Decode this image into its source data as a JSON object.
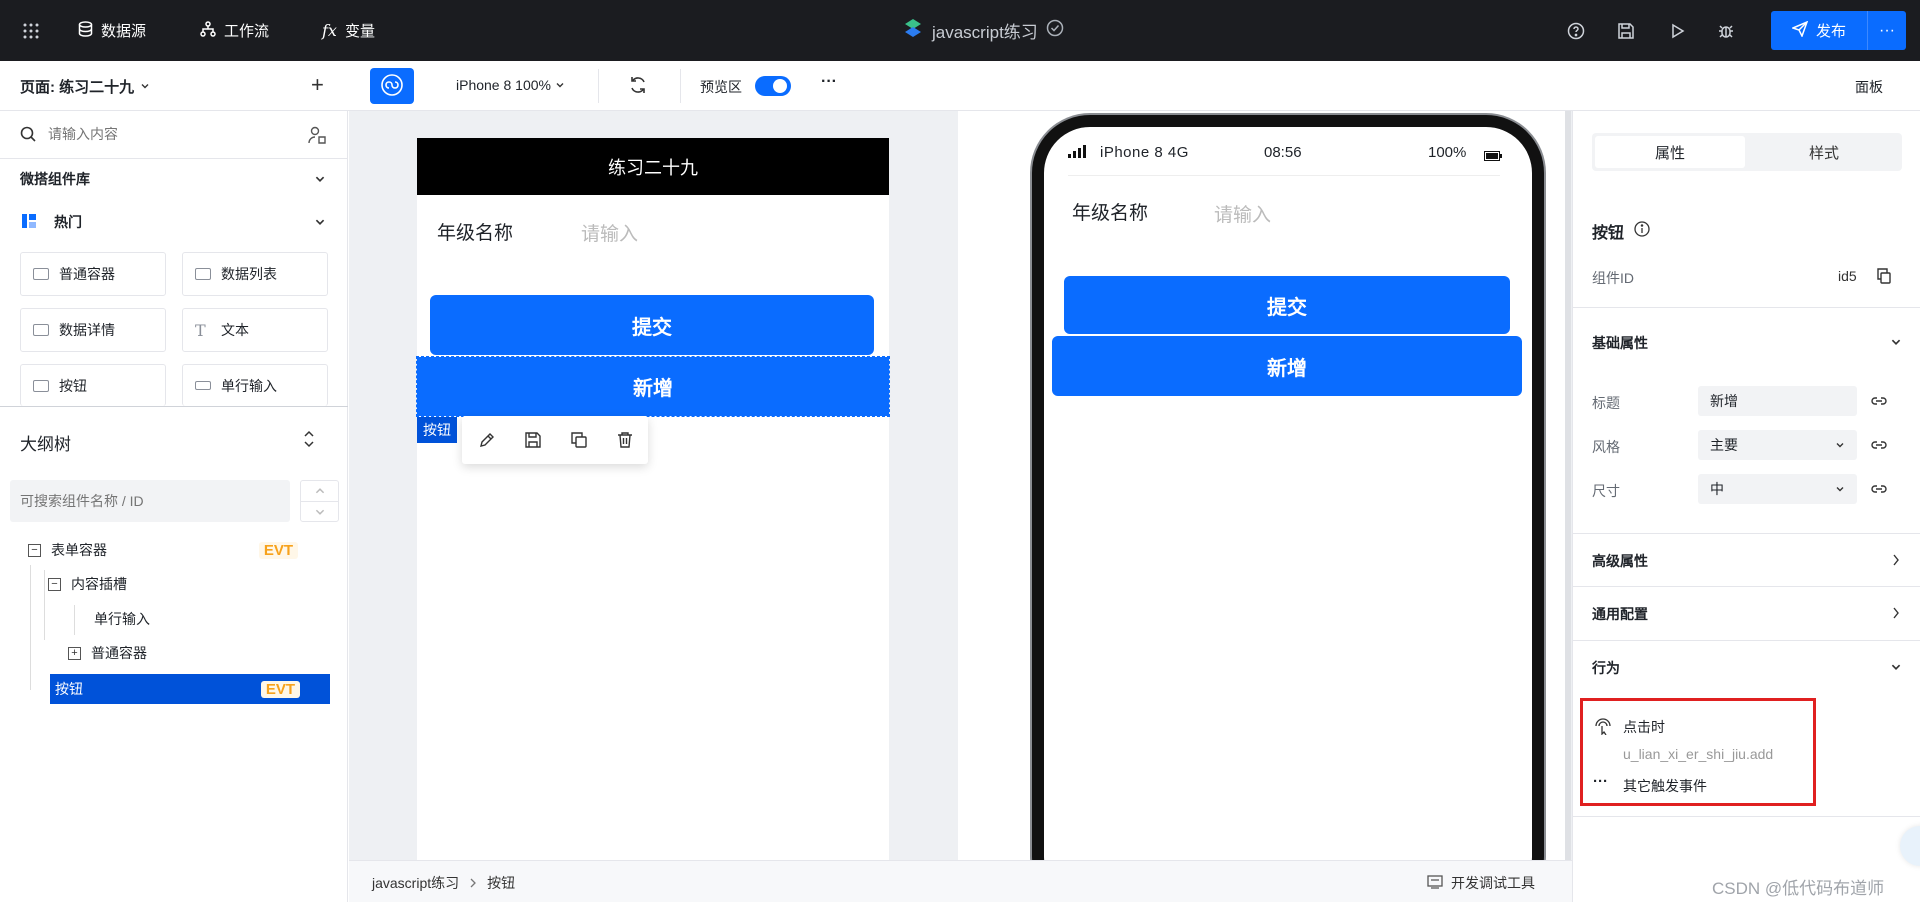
{
  "topbar": {
    "nav": [
      "数据源",
      "工作流",
      "变量"
    ],
    "app_title": "javascript练习",
    "publish_label": "发布",
    "more": "···"
  },
  "toolbar": {
    "device": "iPhone 8 100%",
    "preview_label": "预览区",
    "more": "···",
    "panel_label": "面板"
  },
  "left": {
    "page_label": "页面: 练习二十九",
    "add": "+",
    "search_placeholder": "请输入内容",
    "library_title": "微搭组件库",
    "hot_title": "热门",
    "components": [
      "普通容器",
      "数据列表",
      "数据详情",
      "文本",
      "按钮",
      "单行输入"
    ],
    "outline_title": "大纲树",
    "outline_search_placeholder": "可搜索组件名称 / ID",
    "tree": [
      {
        "label": "表单容器",
        "badge": "EVT"
      },
      {
        "label": "内容插槽"
      },
      {
        "label": "单行输入"
      },
      {
        "label": "普通容器"
      },
      {
        "label": "按钮",
        "badge": "EVT"
      }
    ]
  },
  "canvas": {
    "page_title": "练习二十九",
    "field_label": "年级名称",
    "field_placeholder": "请输入",
    "submit_label": "提交",
    "add_label": "新增",
    "selected_tag": "按钮",
    "phone": {
      "carrier": "iPhone 8  4G",
      "time": "08:56",
      "battery": "100%",
      "field_label": "年级名称",
      "field_placeholder": "请输入",
      "submit_label": "提交",
      "add_label": "新增"
    },
    "breadcrumb": [
      "javascript练习",
      "按钮"
    ],
    "devtools_label": "开发调试工具"
  },
  "right": {
    "tabs": [
      "属性",
      "样式"
    ],
    "component_name": "按钮",
    "component_id_label": "组件ID",
    "component_id": "id5",
    "basic_title": "基础属性",
    "props": [
      {
        "label": "标题",
        "value": "新增"
      },
      {
        "label": "风格",
        "value": "主要"
      },
      {
        "label": "尺寸",
        "value": "中"
      }
    ],
    "advanced_title": "高级属性",
    "common_title": "通用配置",
    "behavior_title": "行为",
    "event_label": "点击时",
    "event_handler": "u_lian_xi_er_shi_jiu.add",
    "other_events": "其它触发事件"
  },
  "watermark": "CSDN @低代码布道师",
  "colors": {
    "primary": "#0a6cff",
    "topbar": "#1b1c20",
    "highlight": "#e02020"
  }
}
